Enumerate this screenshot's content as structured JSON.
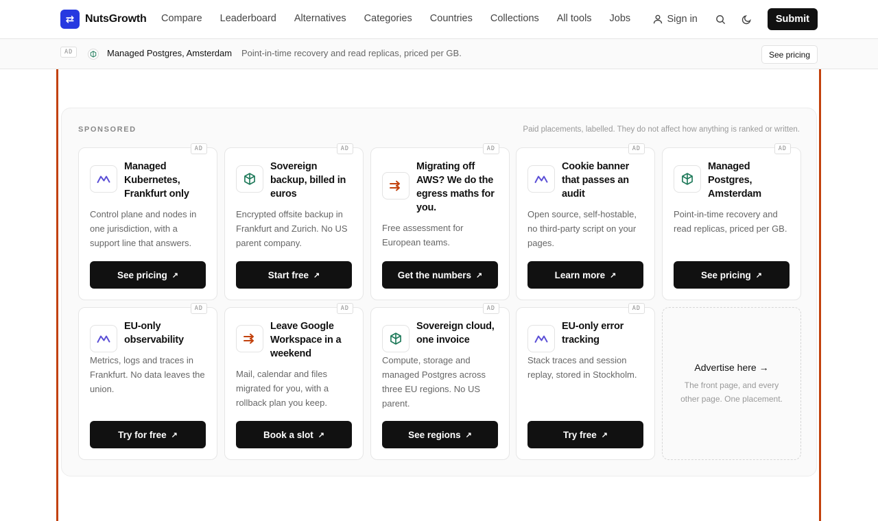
{
  "header": {
    "logo_text": "NutsGrowth",
    "nav": [
      "Compare",
      "Leaderboard",
      "Alternatives",
      "Categories",
      "Countries",
      "Collections",
      "All tools",
      "Jobs"
    ],
    "signin_label": "Sign in",
    "submit_label": "Submit"
  },
  "ad_strip": {
    "badge": "AD",
    "title": "Managed Postgres, Amsterdam",
    "description": "Point-in-time recovery and read replicas, priced per GB.",
    "cta": "See pricing"
  },
  "sponsored": {
    "label": "SPONSORED",
    "note": "Paid placements, labelled. They do not affect how anything is ranked or written.",
    "badge": "AD",
    "cards": [
      {
        "title": "Managed Kubernetes, Frankfurt only",
        "description": "Control plane and nodes in one jurisdiction, with a support line that answers.",
        "cta": "See pricing",
        "icon": "wave-icon"
      },
      {
        "title": "Sovereign backup, billed in euros",
        "description": "Encrypted offsite backup in Frankfurt and Zurich. No US parent company.",
        "cta": "Start free",
        "icon": "cube-icon"
      },
      {
        "title": "Migrating off AWS? We do the egress maths for you.",
        "description": "Free assessment for European teams.",
        "cta": "Get the numbers",
        "icon": "arrow-icon"
      },
      {
        "title": "Cookie banner that passes an audit",
        "description": "Open source, self-hostable, no third-party script on your pages.",
        "cta": "Learn more",
        "icon": "wave-icon"
      },
      {
        "title": "Managed Postgres, Amsterdam",
        "description": "Point-in-time recovery and read replicas, priced per GB.",
        "cta": "See pricing",
        "icon": "cube-icon"
      },
      {
        "title": "EU-only observability",
        "description": "Metrics, logs and traces in Frankfurt. No data leaves the union.",
        "cta": "Try for free",
        "icon": "wave-icon"
      },
      {
        "title": "Leave Google Workspace in a weekend",
        "description": "Mail, calendar and files migrated for you, with a rollback plan you keep.",
        "cta": "Book a slot",
        "icon": "arrow-icon"
      },
      {
        "title": "Sovereign cloud, one invoice",
        "description": "Compute, storage and managed Postgres across three EU regions. No US parent.",
        "cta": "See regions",
        "icon": "cube-icon"
      },
      {
        "title": "EU-only error tracking",
        "description": "Stack traces and session replay, stored in Stockholm.",
        "cta": "Try free",
        "icon": "wave-icon"
      }
    ],
    "advertise": {
      "title": "Advertise here →",
      "description": "The front page, and every other page. One placement."
    }
  },
  "colors": {
    "logo": "#2639e0",
    "rail": "#c2410c",
    "wave_icon": "#5b4fd6",
    "cube_icon": "#1f7a5a",
    "arrow_icon": "#c2410c"
  }
}
